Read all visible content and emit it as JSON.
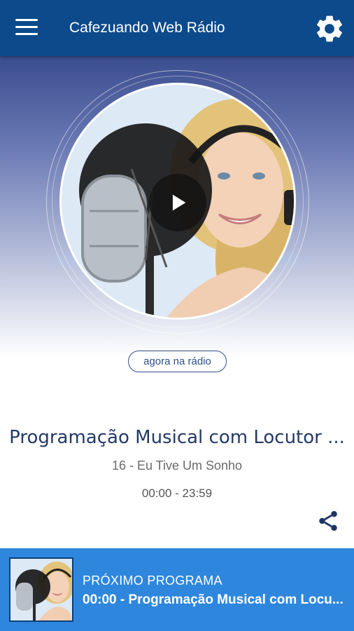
{
  "app": {
    "title": "Cafezuando Web Rádio",
    "accent_color": "#0d4a8c",
    "menu_icon": "hamburger-menu-icon",
    "settings_icon": "gear-icon"
  },
  "player": {
    "play_icon": "play-icon",
    "now_badge": "agora na rádio",
    "program_title": "Programação Musical com Locutor ...",
    "song": "16 - Eu Tive Um Sonho",
    "schedule": "00:00 - 23:59",
    "share_icon": "share-icon"
  },
  "next": {
    "label": "PRÓXIMO PROGRAMA",
    "program": "00:00 - Programação Musical com Locu...",
    "bar_color": "#2e87dd"
  }
}
